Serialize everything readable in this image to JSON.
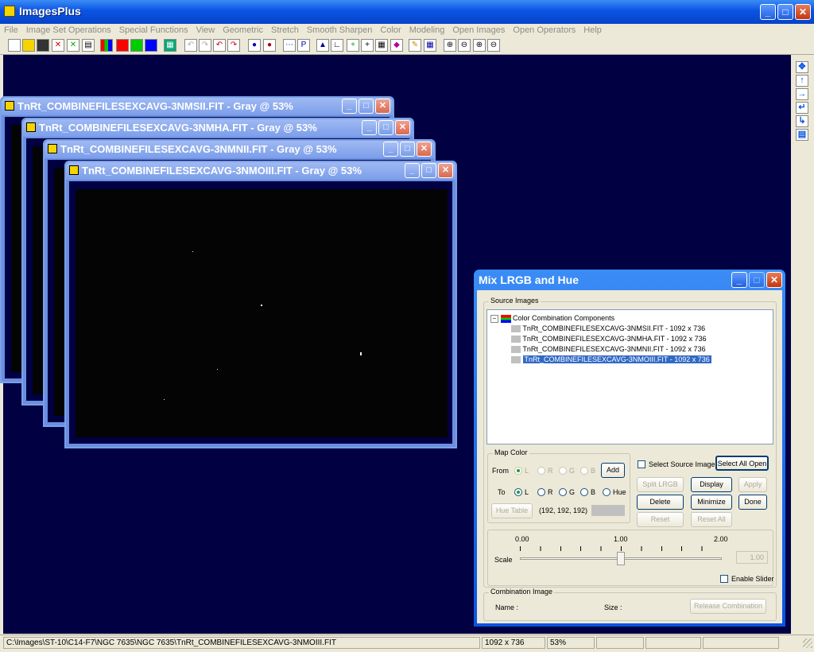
{
  "app": {
    "title": "ImagesPlus"
  },
  "menu": [
    "File",
    "Image Set Operations",
    "Special Functions",
    "View",
    "Geometric",
    "Stretch",
    "Smooth Sharpen",
    "Color",
    "Modeling",
    "Open Images",
    "Open Operators",
    "Help"
  ],
  "windows": [
    {
      "title": "TnRt_COMBINEFILESEXCAVG-3NMSII.FIT - Gray @  53%"
    },
    {
      "title": "TnRt_COMBINEFILESEXCAVG-3NMHA.FIT - Gray @  53%"
    },
    {
      "title": "TnRt_COMBINEFILESEXCAVG-3NMNII.FIT - Gray @  53%"
    },
    {
      "title": "TnRt_COMBINEFILESEXCAVG-3NMOIII.FIT - Gray @  53%"
    }
  ],
  "dialog": {
    "title": "Mix LRGB and Hue",
    "source_images_label": "Source Images",
    "tree_root": "Color Combination Components",
    "tree_items": [
      "TnRt_COMBINEFILESEXCAVG-3NMSII.FIT - 1092 x 736",
      "TnRt_COMBINEFILESEXCAVG-3NMHA.FIT - 1092 x 736",
      "TnRt_COMBINEFILESEXCAVG-3NMNII.FIT - 1092 x 736",
      "TnRt_COMBINEFILESEXCAVG-3NMOIII.FIT - 1092 x 736"
    ],
    "map_color_label": "Map Color",
    "from_label": "From",
    "to_label": "To",
    "radio_L": "L",
    "radio_R": "R",
    "radio_G": "G",
    "radio_B": "B",
    "radio_Hue": "Hue",
    "add_label": "Add",
    "hue_table_label": "Hue Table",
    "rgb_value": "(192, 192, 192)",
    "select_source_label": "Select Source Image",
    "select_all_open": "Select All Open",
    "split_lrgb": "Split LRGB",
    "display": "Display",
    "apply": "Apply",
    "delete": "Delete",
    "minimize": "Minimize",
    "done": "Done",
    "reset": "Reset",
    "reset_all": "Reset All",
    "scale_min": "0.00",
    "scale_mid": "1.00",
    "scale_max": "2.00",
    "scale_label": "Scale",
    "scale_value": "1.00",
    "enable_slider": "Enable Slider",
    "combination_label": "Combination Image",
    "name_label": "Name :",
    "size_label": "Size :",
    "release_label": "Release Combination"
  },
  "status": {
    "path": "C:\\Images\\ST-10\\C14-F7\\NGC 7635\\NGC 7635\\TnRt_COMBINEFILESEXCAVG-3NMOIII.FIT",
    "dimensions": "1092 x 736",
    "zoom": "53%"
  }
}
